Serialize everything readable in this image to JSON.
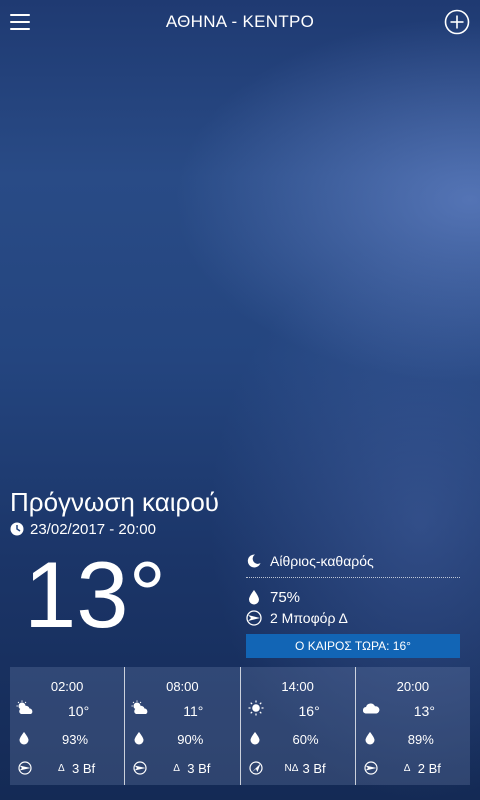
{
  "header": {
    "title": "ΑΘΗΝΑ - ΚΕΝΤΡΟ",
    "menu_icon": "hamburger-menu-icon",
    "add_icon": "plus-circle-icon"
  },
  "current": {
    "heading": "Πρόγνωση καιρού",
    "datetime": "23/02/2017 - 20:00",
    "temperature": "13°",
    "condition": "Αίθριος-καθαρός",
    "condition_icon": "moon-icon",
    "humidity": "75%",
    "wind": "2 Μποφόρ Δ",
    "now_label": "Ο ΚΑΙΡΟΣ ΤΩΡΑ: 16°"
  },
  "hourly": [
    {
      "time": "02:00",
      "icon": "partly-cloudy-icon",
      "temp": "10°",
      "humidity": "93%",
      "wind_dir": "Δ",
      "wind": "3 Bf"
    },
    {
      "time": "08:00",
      "icon": "partly-cloudy-icon",
      "temp": "11°",
      "humidity": "90%",
      "wind_dir": "Δ",
      "wind": "3 Bf"
    },
    {
      "time": "14:00",
      "icon": "sun-icon",
      "temp": "16°",
      "humidity": "60%",
      "wind_dir": "ΝΔ",
      "wind": "3 Bf"
    },
    {
      "time": "20:00",
      "icon": "cloud-icon",
      "temp": "13°",
      "humidity": "89%",
      "wind_dir": "Δ",
      "wind": "2 Bf"
    }
  ],
  "colors": {
    "now_bar": "#1265b5",
    "background_top": "#1f3a72",
    "background_bottom": "#142a55"
  }
}
